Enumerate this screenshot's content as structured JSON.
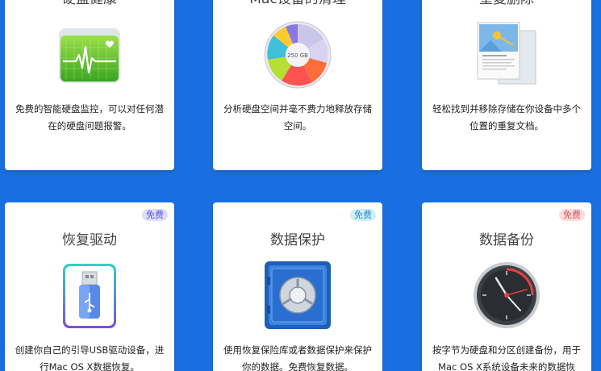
{
  "colors": {
    "background": "#1a6fe0",
    "card": "#ffffff",
    "badge_purple_bg": "#dcdcfa",
    "badge_purple_text": "#5b5bd6",
    "badge_blue_bg": "#cfeefa",
    "badge_blue_text": "#2c8fc4",
    "badge_red_bg": "#fadcdc",
    "badge_red_text": "#d45a5a"
  },
  "cards": [
    {
      "title": "硬盘健康",
      "icon": "disk-health-icon",
      "description": "免费的智能硬盘监控，可以对任何潜在的硬盘问题报警。"
    },
    {
      "title": "Mac设备的清理",
      "icon": "disk-space-pie-icon",
      "icon_label": "250 GB",
      "description": "分析硬盘空间并毫不费力地释放存储空间。"
    },
    {
      "title": "重复删除",
      "icon": "duplicate-files-icon",
      "description": "轻松找到并移除存储在你设备中多个位置的重复文档。"
    },
    {
      "title": "恢复驱动",
      "icon": "usb-drive-icon",
      "badge": "免费",
      "description": "创建你自己的引导USB驱动设备，进行Mac OS X数据恢复。"
    },
    {
      "title": "数据保护",
      "icon": "vault-icon",
      "badge": "免费",
      "description": "使用恢复保险库或者数据保护来保护你的数据。免费恢复数据。"
    },
    {
      "title": "数据备份",
      "icon": "backup-clock-icon",
      "badge": "免费",
      "description": "按字节为硬盘和分区创建备份，用于Mac OS X系统设备未来的数据恢"
    }
  ]
}
